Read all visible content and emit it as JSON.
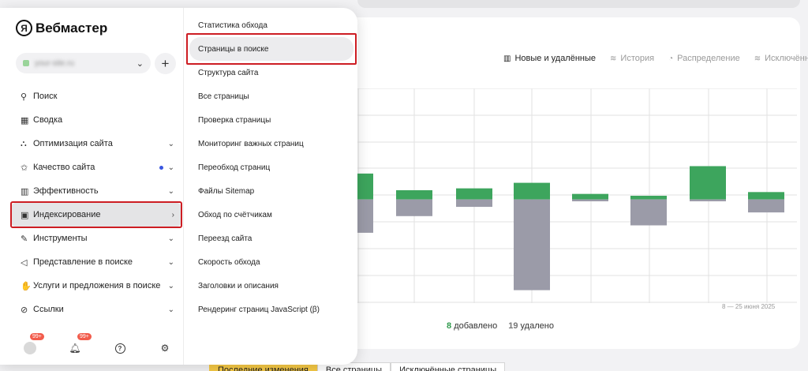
{
  "app": {
    "logo_mark": "Я",
    "logo_text": "Вебмастер"
  },
  "site": {
    "name": "your-site.ru",
    "add_label": "+"
  },
  "sidebar": {
    "items": [
      {
        "label": "Поиск",
        "icon": "search-icon",
        "glyph": "⚲"
      },
      {
        "label": "Сводка",
        "icon": "dashboard-icon",
        "glyph": "▦"
      },
      {
        "label": "Оптимизация сайта",
        "icon": "sitemap-icon",
        "glyph": "⛬"
      },
      {
        "label": "Качество сайта",
        "icon": "star-icon",
        "glyph": "✩"
      },
      {
        "label": "Эффективность",
        "icon": "bar-chart-icon",
        "glyph": "▥"
      },
      {
        "label": "Индексирование",
        "icon": "monitor-icon",
        "glyph": "▣"
      },
      {
        "label": "Инструменты",
        "icon": "wrench-icon",
        "glyph": "✎"
      },
      {
        "label": "Представление в поиске",
        "icon": "megaphone-icon",
        "glyph": "◁"
      },
      {
        "label": "Услуги и предложения в поиске",
        "icon": "hand-icon",
        "glyph": "✋"
      },
      {
        "label": "Ссылки",
        "icon": "link-icon",
        "glyph": "⊘"
      }
    ]
  },
  "footer": {
    "avatar_badge": "99+",
    "bell_badge": "99+",
    "help_glyph": "?",
    "settings_glyph": "⚙"
  },
  "submenu": {
    "items": [
      "Статистика обхода",
      "Страницы в поиске",
      "Структура сайта",
      "Все страницы",
      "Проверка страницы",
      "Мониторинг важных страниц",
      "Переобход страниц",
      "Файлы Sitemap",
      "Обход по счётчикам",
      "Переезд сайта",
      "Скорость обхода",
      "Заголовки и описания",
      "Рендеринг страниц JavaScript (β)"
    ]
  },
  "view_tabs": [
    "Новые и удалённые",
    "История",
    "Распределение",
    "Исключённые"
  ],
  "summary": {
    "added": "8",
    "added_label": "добавлено",
    "removed": "19",
    "removed_label": "удалено"
  },
  "date_range": "8 — 25 июня 2025",
  "bottom_tabs": [
    "Последние изменения",
    "Все страницы",
    "Исключённые страницы"
  ],
  "colors": {
    "added": "#3da55d",
    "removed": "#9b9ba8",
    "accent": "#cd1d23"
  },
  "chart_data": {
    "type": "bar",
    "series": [
      {
        "name": "добавлено",
        "values": [
          1.4,
          0.5,
          0.6,
          0.9,
          0.3,
          0.2,
          1.8,
          0.4
        ]
      },
      {
        "name": "удалено",
        "values": [
          -1.8,
          -0.9,
          -0.4,
          -4.9,
          -0.1,
          -1.4,
          -0.1,
          -0.7
        ]
      }
    ],
    "ylim": [
      -5.6,
      6.0
    ],
    "grid": true
  }
}
